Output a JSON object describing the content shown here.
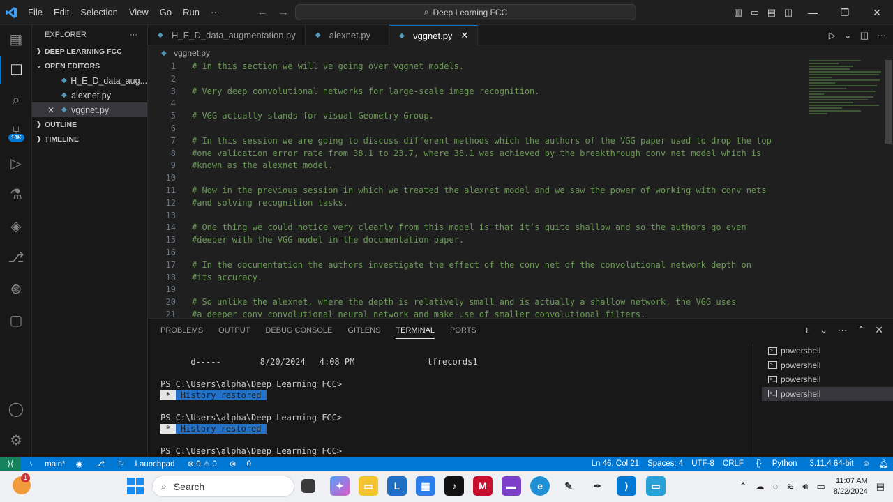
{
  "titlebar": {
    "menu": [
      "File",
      "Edit",
      "Selection",
      "View",
      "Go",
      "Run",
      "···"
    ],
    "search_text": "Deep Learning FCC"
  },
  "explorer": {
    "title": "EXPLORER",
    "workspace": "DEEP LEARNING FCC",
    "open_editors": "OPEN EDITORS",
    "files": [
      "H_E_D_data_aug...",
      "alexnet.py",
      "vggnet.py"
    ],
    "outline": "OUTLINE",
    "timeline": "TIMELINE"
  },
  "activity": {
    "badge": "10K"
  },
  "tabs": [
    {
      "label": "H_E_D_data_augmentation.py"
    },
    {
      "label": "alexnet.py"
    },
    {
      "label": "vggnet.py"
    }
  ],
  "breadcrumb": "vggnet.py",
  "code_lines": [
    {
      "n": "1",
      "t": "# In this section we will ve going over vggnet models."
    },
    {
      "n": "2",
      "t": ""
    },
    {
      "n": "3",
      "t": "# Very deep convolutional networks for large-scale image recognition."
    },
    {
      "n": "4",
      "t": ""
    },
    {
      "n": "5",
      "t": "# VGG actually stands for visual Geometry Group."
    },
    {
      "n": "6",
      "t": ""
    },
    {
      "n": "7",
      "t": "# In this session we are going to discuss different methods which the authors of the VGG paper used to drop the top"
    },
    {
      "n": "8",
      "t": "#one validation error rate from 38.1 to 23.7, where 38.1 was achieved by the breakthrough conv net model which is"
    },
    {
      "n": "9",
      "t": "#known as the alexnet model."
    },
    {
      "n": "10",
      "t": ""
    },
    {
      "n": "11",
      "t": "# Now in the previous session in which we treated the alexnet model and we saw the power of working with conv nets"
    },
    {
      "n": "12",
      "t": "#and solving recognition tasks."
    },
    {
      "n": "13",
      "t": ""
    },
    {
      "n": "14",
      "t": "# One thing we could notice very clearly from this model is that it’s quite shallow and so the authors go even"
    },
    {
      "n": "15",
      "t": "#deeper with the VGG model in the documentation paper."
    },
    {
      "n": "16",
      "t": ""
    },
    {
      "n": "17",
      "t": "# In the documentation the authors investigate the effect of the conv net of the convolutional network depth on"
    },
    {
      "n": "18",
      "t": "#its accuracy."
    },
    {
      "n": "19",
      "t": ""
    },
    {
      "n": "20",
      "t": "# So unlike the alexnet, where the depth is relatively small and is actually a shallow network, the VGG uses"
    },
    {
      "n": "21",
      "t": "#a deeper conv convolutional neural network and make use of smaller convolutional filters."
    }
  ],
  "panel": {
    "tabs": [
      "PROBLEMS",
      "OUTPUT",
      "DEBUG CONSOLE",
      "GITLENS",
      "TERMINAL",
      "PORTS"
    ],
    "active_tab": "TERMINAL",
    "terminal_lines": {
      "dir_mode": "d-----",
      "dir_date": "8/20/2024",
      "dir_time": "4:08 PM",
      "dir_name": "tfrecords1",
      "prompt": "PS C:\\Users\\alpha\\Deep Learning FCC>",
      "history_star": " * ",
      "history_text": " History restored "
    },
    "terminals": [
      "powershell",
      "powershell",
      "powershell",
      "powershell"
    ]
  },
  "status": {
    "branch": "main*",
    "launchpad": "Launchpad",
    "problems": "⊗ 0 ⚠ 0",
    "ports": "0",
    "cursor": "Ln 46, Col 21",
    "spaces": "Spaces: 4",
    "encoding": "UTF-8",
    "eol": "CRLF",
    "language": "Python",
    "interpreter": "3.11.4 64-bit"
  },
  "taskbar": {
    "weather_badge": "1",
    "search_label": "Search",
    "time": "11:07 AM",
    "date": "8/22/2024"
  }
}
